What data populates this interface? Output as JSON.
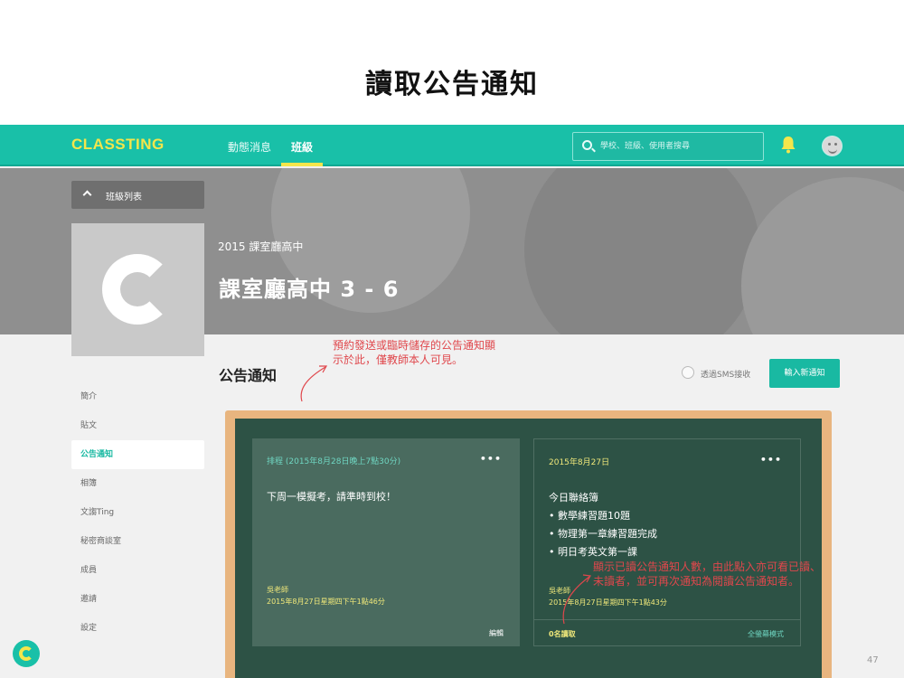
{
  "slide": {
    "title": "讀取公告通知",
    "page_number": "47"
  },
  "topbar": {
    "logo": "CLASSTING",
    "nav": [
      "動態消息",
      "班級"
    ],
    "search_placeholder": "學校、班級、使用者搜尋",
    "accent_color": "#19c0a8",
    "highlight_color": "#f4e64b"
  },
  "class": {
    "list_button": "班級列表",
    "school": "2015 課室廳高中",
    "name": "課室廳高中 3 - 6"
  },
  "sidebar": {
    "items": [
      "簡介",
      "貼文",
      "公告通知",
      "相簿",
      "文謅Ting",
      "秘密商談室",
      "成員",
      "邀請",
      "設定"
    ],
    "active": "公告通知"
  },
  "notices": {
    "title": "公告通知",
    "sms_label": "透過SMS接收",
    "new_button": "輸入新通知",
    "cards": [
      {
        "header": "排程 (2015年8月28日晚上7點30分)",
        "menu": "•••",
        "lines": [
          "下周一模擬考，請準時到校！"
        ],
        "author": "吳老師",
        "date": "2015年8月27日星期四下午1點46分",
        "footer_right": "編輯"
      },
      {
        "header": "2015年8月27日",
        "menu": "•••",
        "lines": [
          "今日聯絡簿",
          "• 數學練習題10題",
          "• 物理第一章練習題完成",
          "• 明日考英文第一課"
        ],
        "author": "吳老師",
        "date": "2015年8月27日星期四下午1點43分",
        "footer_left": "0名讀取",
        "footer_right": "全螢幕模式"
      }
    ]
  },
  "annotations": {
    "scheduled": [
      "預約發送或臨時儲存的公告通知顯",
      "示於此，僅教師本人可見。"
    ],
    "readers": [
      "顯示已讀公告通知人數，由此點入亦可看已讀、",
      "未讀者，並可再次通知為閱讀公告通知者。"
    ],
    "color": "#e0474c"
  }
}
